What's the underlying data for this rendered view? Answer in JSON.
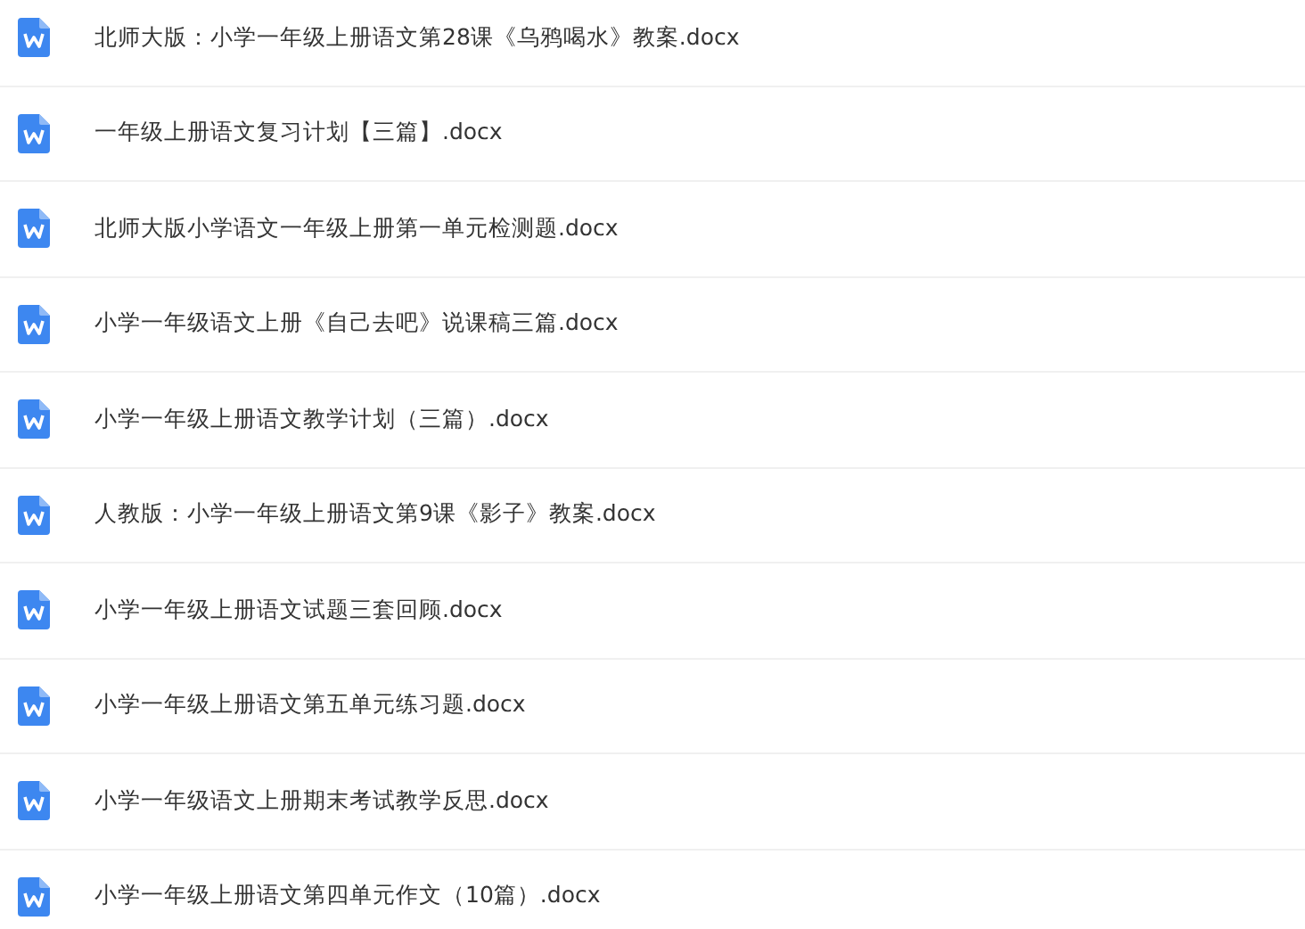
{
  "files": [
    {
      "name": "北师大版：小学一年级上册语文第28课《乌鸦喝水》教案.docx"
    },
    {
      "name": "一年级上册语文复习计划【三篇】.docx"
    },
    {
      "name": "北师大版小学语文一年级上册第一单元检测题.docx"
    },
    {
      "name": "小学一年级语文上册《自己去吧》说课稿三篇.docx"
    },
    {
      "name": "小学一年级上册语文教学计划（三篇）.docx"
    },
    {
      "name": "人教版：小学一年级上册语文第9课《影子》教案.docx"
    },
    {
      "name": "小学一年级上册语文试题三套回顾.docx"
    },
    {
      "name": "小学一年级上册语文第五单元练习题.docx"
    },
    {
      "name": "小学一年级语文上册期末考试教学反思.docx"
    },
    {
      "name": "小学一年级上册语文第四单元作文（10篇）.docx"
    }
  ]
}
